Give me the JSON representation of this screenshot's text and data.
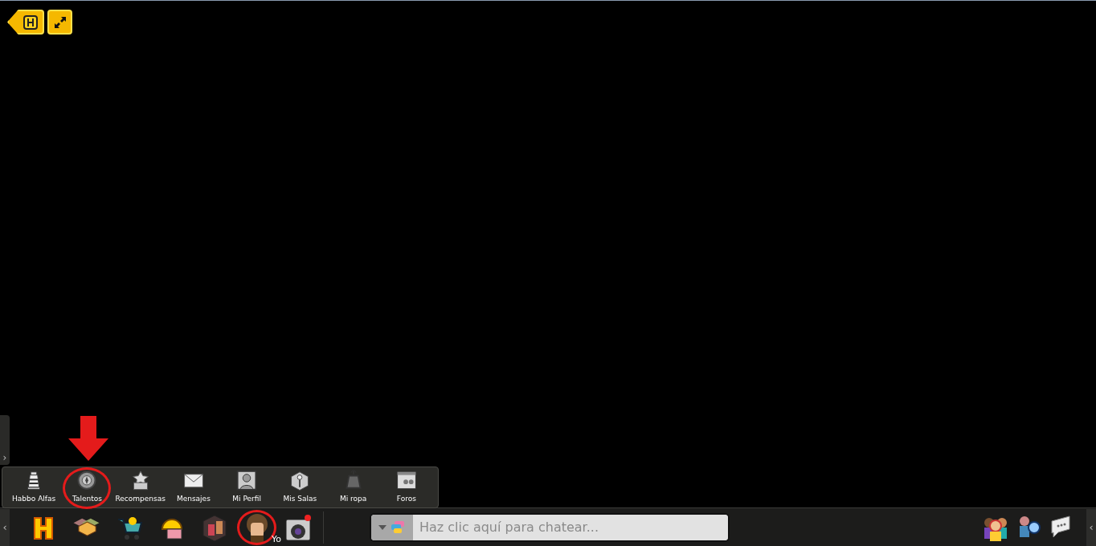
{
  "side_tab": "›",
  "menu_items": [
    {
      "label": "Habbo Alfas",
      "circled": false,
      "arrow": false
    },
    {
      "label": "Talentos",
      "circled": true,
      "arrow": true
    },
    {
      "label": "Recompensas",
      "circled": false,
      "arrow": false
    },
    {
      "label": "Mensajes",
      "circled": false,
      "arrow": false
    },
    {
      "label": "Mi Perfil",
      "circled": false,
      "arrow": false
    },
    {
      "label": "Mis Salas",
      "circled": false,
      "arrow": false
    },
    {
      "label": "Mi ropa",
      "circled": false,
      "arrow": false
    },
    {
      "label": "Foros",
      "circled": false,
      "arrow": false
    }
  ],
  "toolbar": {
    "left_toggle": "‹",
    "right_toggle": "‹",
    "avatar_circled": true,
    "avatar_label": "Yo"
  },
  "chat": {
    "placeholder": "Haz clic aquí para chatear..."
  }
}
